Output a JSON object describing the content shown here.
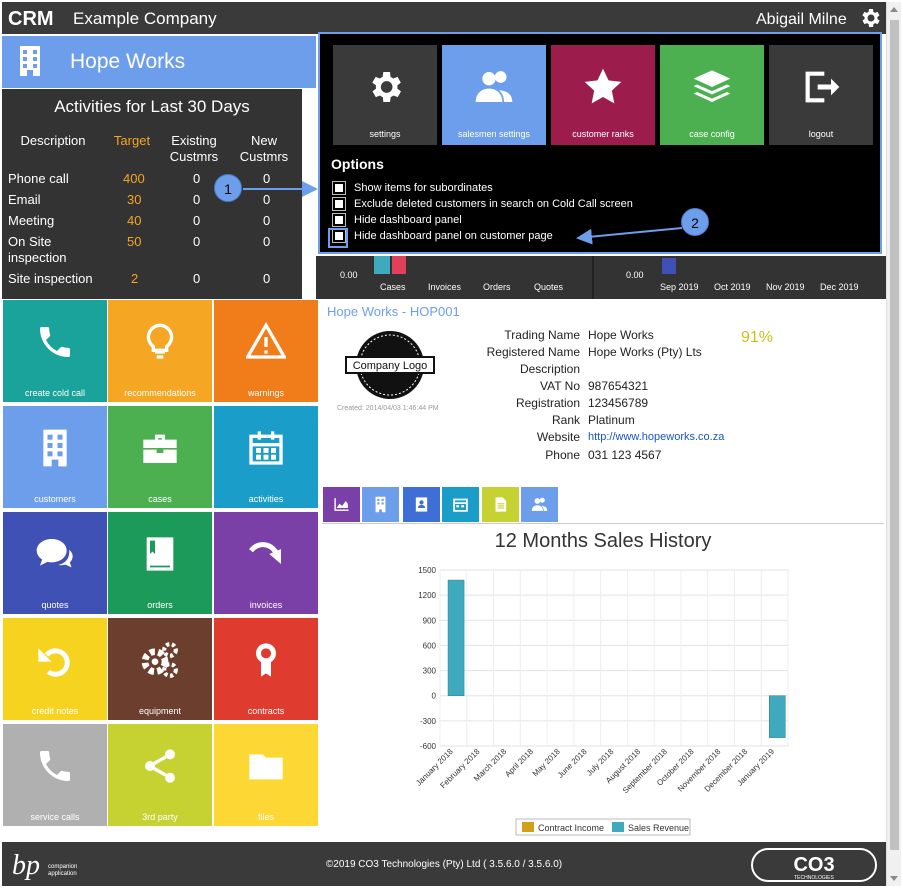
{
  "topbar": {
    "logo_text": "CRM",
    "company": "Example Company",
    "user": "Abigail Milne"
  },
  "customer_header": {
    "title": "Hope Works"
  },
  "activities": {
    "title": "Activities for Last 30 Days",
    "headers": {
      "description": "Description",
      "target": "Target",
      "existing": "Existing Custmrs",
      "new": "New Custmrs"
    },
    "rows": [
      {
        "desc": "Phone call",
        "target": "400",
        "existing": "0",
        "new": "0"
      },
      {
        "desc": "Email",
        "target": "30",
        "existing": "0",
        "new": "0"
      },
      {
        "desc": "Meeting",
        "target": "40",
        "existing": "0",
        "new": "0"
      },
      {
        "desc": "On Site inspection",
        "target": "50",
        "existing": "0",
        "new": "0"
      },
      {
        "desc": "Site inspection",
        "target": "2",
        "existing": "0",
        "new": "0"
      }
    ]
  },
  "mini_charts": {
    "left_axis": "0.00",
    "left_labels": [
      "Cases",
      "Invoices",
      "Orders",
      "Quotes"
    ],
    "right_axis": "0.00",
    "right_labels": [
      "Sep 2019",
      "Oct 2019",
      "Nov 2019",
      "Dec 2019"
    ]
  },
  "options_panel": {
    "tiles": [
      {
        "label": "settings",
        "icon": "gear-icon",
        "color": "#3a3a3a"
      },
      {
        "label": "salesmen settings",
        "icon": "users-icon",
        "color": "#6d9eeb"
      },
      {
        "label": "customer ranks",
        "icon": "star-icon",
        "color": "#9c1d4c"
      },
      {
        "label": "case config",
        "icon": "layers-icon",
        "color": "#4caf50"
      },
      {
        "label": "logout",
        "icon": "logout-icon",
        "color": "#3a3a3a"
      }
    ],
    "heading": "Options",
    "checkboxes": [
      {
        "label": "Show items for subordinates",
        "checked": false
      },
      {
        "label": "Exclude deleted customers in search on Cold Call screen",
        "checked": false
      },
      {
        "label": "Hide dashboard panel",
        "checked": false
      },
      {
        "label": "Hide dashboard panel on customer page",
        "checked": false
      }
    ]
  },
  "callouts": [
    "1",
    "2"
  ],
  "tiles": [
    {
      "label": "create cold call",
      "icon": "phone-icon",
      "color": "#1aa39a"
    },
    {
      "label": "recommendations",
      "icon": "lightbulb-icon",
      "color": "#f5a623"
    },
    {
      "label": "warnings",
      "icon": "warning-icon",
      "color": "#f07d1a"
    },
    {
      "label": "customers",
      "icon": "building-icon",
      "color": "#6d9eeb"
    },
    {
      "label": "cases",
      "icon": "briefcase-icon",
      "color": "#4caf50"
    },
    {
      "label": "activities",
      "icon": "calendar-icon",
      "color": "#1a9ec9"
    },
    {
      "label": "quotes",
      "icon": "chat-icon",
      "color": "#3f51b5"
    },
    {
      "label": "orders",
      "icon": "bookmark-book-icon",
      "color": "#1b9a5a"
    },
    {
      "label": "invoices",
      "icon": "redo-arrow-icon",
      "color": "#7b3fa8"
    },
    {
      "label": "credit notes",
      "icon": "undo-arrow-icon",
      "color": "#f5d31f"
    },
    {
      "label": "equipment",
      "icon": "gears-icon",
      "color": "#6b3e2e"
    },
    {
      "label": "contracts",
      "icon": "award-icon",
      "color": "#e03b2f"
    },
    {
      "label": "service calls",
      "icon": "phone-icon",
      "color": "#b0b0b0"
    },
    {
      "label": "3rd party",
      "icon": "share-icon",
      "color": "#c6d232"
    },
    {
      "label": "files",
      "icon": "folder-icon",
      "color": "#fdd835"
    }
  ],
  "customer": {
    "title": "Hope Works - HOP001",
    "logo_text": "Company Logo",
    "created": "Created: 2014/04/03 1:46:44 PM",
    "percent": "91%",
    "fields": [
      {
        "label": "Trading Name",
        "value": "Hope Works"
      },
      {
        "label": "Registered Name",
        "value": "Hope Works (Pty) Lts"
      },
      {
        "label": "Description",
        "value": ""
      },
      {
        "label": "VAT No",
        "value": "987654321"
      },
      {
        "label": "Registration",
        "value": "123456789"
      },
      {
        "label": "Rank",
        "value": "Platinum"
      },
      {
        "label": "Website",
        "value": "http://www.hopeworks.co.za"
      },
      {
        "label": "Phone",
        "value": "031 123 4567"
      }
    ],
    "tabs": [
      {
        "icon": "area-chart-icon",
        "color": "#7b3fa8"
      },
      {
        "icon": "building-icon",
        "color": "#6d9eeb"
      },
      {
        "icon": "contact-book-icon",
        "color": "#3f6fd6"
      },
      {
        "icon": "calendar-icon",
        "color": "#1a9ec9"
      },
      {
        "icon": "document-icon",
        "color": "#c6d232"
      },
      {
        "icon": "users-icon",
        "color": "#6d9eeb"
      }
    ]
  },
  "chart_data": {
    "type": "bar",
    "title": "12 Months Sales History",
    "categories": [
      "January 2018",
      "February 2018",
      "March 2018",
      "April 2018",
      "May 2018",
      "June 2018",
      "July 2018",
      "August 2018",
      "September 2018",
      "October 2018",
      "November 2018",
      "December 2018",
      "January 2019"
    ],
    "series": [
      {
        "name": "Contract Income",
        "values": [
          0,
          0,
          0,
          0,
          0,
          0,
          0,
          0,
          0,
          0,
          0,
          0,
          0
        ],
        "color": "#d4a017"
      },
      {
        "name": "Sales Revenue",
        "values": [
          1380,
          0,
          0,
          0,
          0,
          0,
          0,
          0,
          0,
          0,
          0,
          0,
          -500
        ],
        "color": "#3fa9bd"
      }
    ],
    "ylim": [
      -600,
      1500
    ],
    "yticks": [
      "1500",
      "1200",
      "900",
      "600",
      "300",
      "0",
      "-300",
      "-600"
    ],
    "grid": true,
    "legend": "bottom"
  },
  "footer": {
    "copyright": "©2019 CO3 Technologies (Pty) Ltd ( 3.5.6.0 / 3.5.6.0)",
    "bp_text": "a companion application",
    "co3_text": "CO3",
    "co3_sub": "TECHNOLOGIES"
  }
}
